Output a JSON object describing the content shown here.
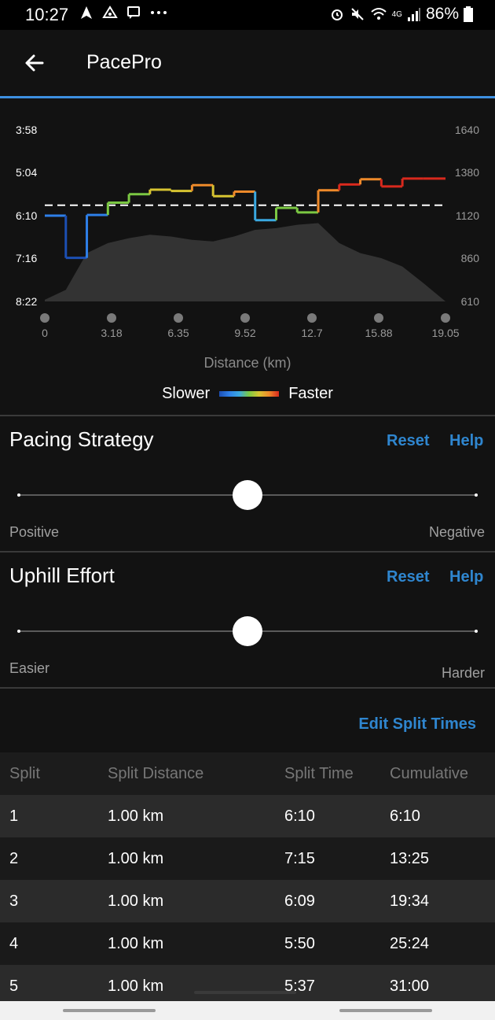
{
  "status_bar": {
    "time": "10:27",
    "battery": "86%",
    "left_icons": [
      "navigation-icon",
      "drive-icon",
      "message-icon",
      "more-icon"
    ],
    "right_icons": [
      "alarm-icon",
      "mute-icon",
      "wifi-icon",
      "4g-icon",
      "signal-icon",
      "battery-icon"
    ],
    "network": "4G"
  },
  "app_bar": {
    "title": "PacePro"
  },
  "chart": {
    "y_left_ticks": [
      "3:58",
      "5:04",
      "6:10",
      "7:16",
      "8:22"
    ],
    "y_right_ticks": [
      "1640",
      "1380",
      "1120",
      "860",
      "610"
    ],
    "x_ticks": [
      "0",
      "3.18",
      "6.35",
      "9.52",
      "12.7",
      "15.88",
      "19.05"
    ],
    "x_label": "Distance (km)",
    "legend_slower": "Slower",
    "legend_faster": "Faster"
  },
  "chart_data": {
    "type": "line",
    "xlabel": "Distance (km)",
    "ylabel_left": "",
    "ylabel_right": "",
    "x_range": [
      0,
      19.05
    ],
    "y_left_range_sec": [
      238,
      502
    ],
    "y_right_range": [
      610,
      1640
    ],
    "target_pace_line_sec": 354,
    "series": [
      {
        "name": "",
        "splits_km": [
          [
            0,
            1
          ],
          [
            1,
            2
          ],
          [
            2,
            3
          ],
          [
            3,
            4
          ],
          [
            4,
            5
          ],
          [
            5,
            6
          ],
          [
            6,
            7
          ],
          [
            7,
            8
          ],
          [
            8,
            9
          ],
          [
            9,
            10
          ],
          [
            10,
            11
          ],
          [
            11,
            12
          ],
          [
            12,
            13
          ],
          [
            13,
            14
          ],
          [
            14,
            15
          ],
          [
            15,
            16
          ],
          [
            16,
            17
          ],
          [
            17,
            18
          ],
          [
            18,
            19.05
          ]
        ],
        "pace_sec": [
          370,
          435,
          369,
          350,
          337,
          330,
          332,
          323,
          340,
          333,
          377,
          358,
          365,
          331,
          322,
          314,
          325,
          313,
          313
        ],
        "colors": [
          "#2e7fe8",
          "#1c4fb3",
          "#2e7fe8",
          "#7bc843",
          "#7bc843",
          "#d6c331",
          "#d6c331",
          "#ee8a2a",
          "#d6c331",
          "#ee8a2a",
          "#3aa8e0",
          "#7bc843",
          "#7bc843",
          "#ee8a2a",
          "#d8291d",
          "#ee8a2a",
          "#d8291d",
          "#d8291d",
          "#d8291d"
        ]
      },
      {
        "name": "",
        "type": "area",
        "x_km": [
          0,
          1,
          2,
          3,
          4,
          5,
          6,
          7,
          8,
          9,
          10,
          11,
          12,
          13,
          14,
          15,
          16,
          17,
          18,
          19.05
        ],
        "elevation": [
          620,
          680,
          900,
          960,
          990,
          1010,
          1000,
          980,
          970,
          1000,
          1040,
          1050,
          1070,
          1080,
          960,
          900,
          870,
          820,
          720,
          610
        ]
      }
    ]
  },
  "pacing_strategy": {
    "title": "Pacing Strategy",
    "reset": "Reset",
    "help": "Help",
    "left_label": "Positive",
    "right_label": "Negative",
    "value": 0.5
  },
  "uphill_effort": {
    "title": "Uphill Effort",
    "reset": "Reset",
    "help": "Help",
    "left_label": "Easier",
    "right_label": "Harder",
    "value": 0.5
  },
  "edit_split_times": "Edit Split Times",
  "splits_table": {
    "headers": [
      "Split",
      "Split Distance",
      "Split Time",
      "Cumulative"
    ],
    "rows": [
      [
        "1",
        "1.00 km",
        "6:10",
        "6:10"
      ],
      [
        "2",
        "1.00 km",
        "7:15",
        "13:25"
      ],
      [
        "3",
        "1.00 km",
        "6:09",
        "19:34"
      ],
      [
        "4",
        "1.00 km",
        "5:50",
        "25:24"
      ],
      [
        "5",
        "1.00 km",
        "5:37",
        "31:00"
      ]
    ]
  }
}
